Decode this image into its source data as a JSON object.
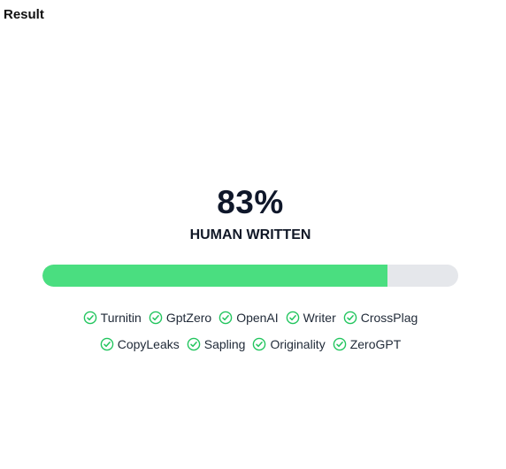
{
  "header": {
    "title": "Result"
  },
  "result": {
    "score_text": "83%",
    "score_fraction": 0.83,
    "verdict": "HUMAN WRITTEN"
  },
  "colors": {
    "progress_fill": "#4ade80",
    "progress_track": "#e5e7eb",
    "check_icon": "#22c55e"
  },
  "detectors": {
    "row1": [
      {
        "label": "Turnitin",
        "icon": "check-circle-icon"
      },
      {
        "label": "GptZero",
        "icon": "check-circle-icon"
      },
      {
        "label": "OpenAI",
        "icon": "check-circle-icon"
      },
      {
        "label": "Writer",
        "icon": "check-circle-icon"
      },
      {
        "label": "CrossPlag",
        "icon": "check-circle-icon"
      }
    ],
    "row2": [
      {
        "label": "CopyLeaks",
        "icon": "check-circle-icon"
      },
      {
        "label": "Sapling",
        "icon": "check-circle-icon"
      },
      {
        "label": "Originality",
        "icon": "check-circle-icon"
      },
      {
        "label": "ZeroGPT",
        "icon": "check-circle-icon"
      }
    ]
  }
}
